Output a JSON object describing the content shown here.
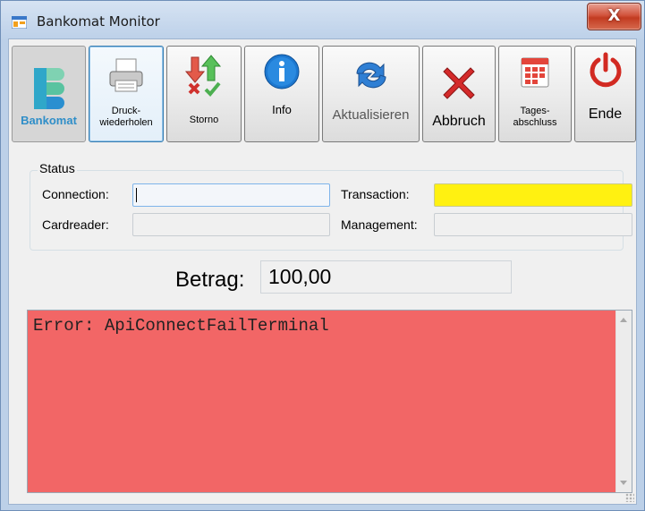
{
  "window": {
    "title": "Bankomat Monitor",
    "close_symbol": "X"
  },
  "toolbar": {
    "logo_label": "Bankomat",
    "reprint_label_line1": "Druck-",
    "reprint_label_line2": "wiederholen",
    "storno_label": "Storno",
    "info_label": "Info",
    "refresh_label": "Aktualisieren",
    "cancel_label": "Abbruch",
    "dayclose_label_line1": "Tages-",
    "dayclose_label_line2": "abschluss",
    "exit_label": "Ende"
  },
  "status": {
    "group_title": "Status",
    "connection_label": "Connection:",
    "connection_value": "",
    "cardreader_label": "Cardreader:",
    "cardreader_value": "",
    "transaction_label": "Transaction:",
    "transaction_value": "",
    "transaction_color": "#fff111",
    "management_label": "Management:",
    "management_value": ""
  },
  "amount": {
    "label": "Betrag:",
    "value": "100,00"
  },
  "log": {
    "text": "Error: ApiConnectFailTerminal",
    "background": "#f26666"
  },
  "icons": [
    "app-icon",
    "bankomat-logo",
    "printer-icon",
    "storno-arrows-icon",
    "info-icon",
    "refresh-icon",
    "cancel-x-icon",
    "calendar-icon",
    "power-icon",
    "close-icon"
  ]
}
